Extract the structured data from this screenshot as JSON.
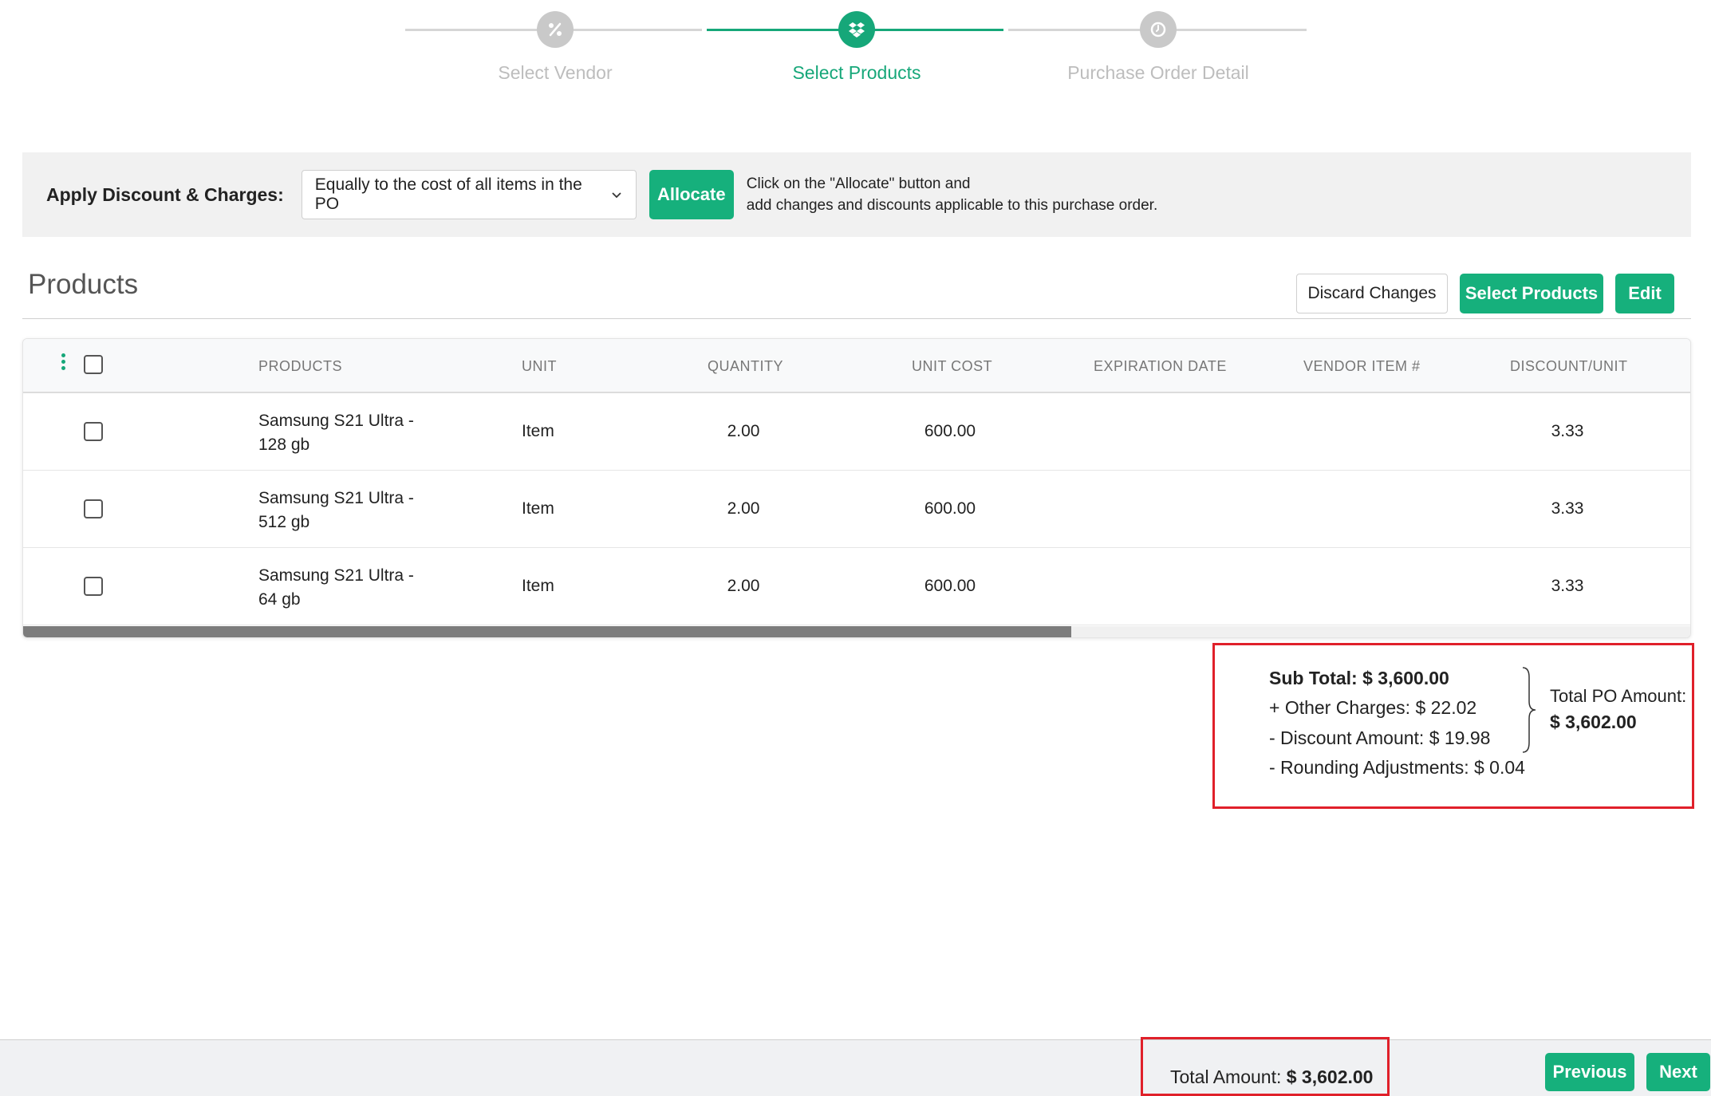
{
  "stepper": {
    "steps": [
      {
        "label": "Select Vendor",
        "icon": "percent-icon",
        "state": "inactive"
      },
      {
        "label": "Select Products",
        "icon": "dropbox-icon",
        "state": "active"
      },
      {
        "label": "Purchase Order Detail",
        "icon": "clock-icon",
        "state": "inactive"
      }
    ]
  },
  "discount": {
    "label": "Apply Discount & Charges:",
    "selected": "Equally to the cost of all items in the PO",
    "allocate_label": "Allocate",
    "hint_line1": "Click on the \"Allocate\" button and",
    "hint_line2": "add changes and discounts applicable to this purchase order."
  },
  "products": {
    "title": "Products",
    "discard_label": "Discard Changes",
    "select_label": "Select Products",
    "edit_label": "Edit"
  },
  "table": {
    "columns": [
      "PRODUCTS",
      "UNIT",
      "QUANTITY",
      "UNIT COST",
      "EXPIRATION DATE",
      "VENDOR ITEM #",
      "DISCOUNT/UNIT"
    ],
    "rows": [
      {
        "name_line1": "Samsung S21 Ultra -",
        "name_line2": "128 gb",
        "unit": "Item",
        "quantity": "2.00",
        "unit_cost": "600.00",
        "expiration": "",
        "vendor_item": "",
        "discount_unit": "3.33"
      },
      {
        "name_line1": "Samsung S21 Ultra -",
        "name_line2": "512 gb",
        "unit": "Item",
        "quantity": "2.00",
        "unit_cost": "600.00",
        "expiration": "",
        "vendor_item": "",
        "discount_unit": "3.33"
      },
      {
        "name_line1": "Samsung S21 Ultra -",
        "name_line2": "64 gb",
        "unit": "Item",
        "quantity": "2.00",
        "unit_cost": "600.00",
        "expiration": "",
        "vendor_item": "",
        "discount_unit": "3.33"
      }
    ]
  },
  "summary": {
    "sub_total": "Sub Total: $ 3,600.00",
    "other_charges": "+ Other Charges: $ 22.02",
    "discount_amount": "- Discount Amount: $ 19.98",
    "rounding": "- Rounding Adjustments: $ 0.04",
    "total_po_label": "Total PO Amount:",
    "total_po_value": "$ 3,602.00"
  },
  "footer": {
    "total_label": "Total Amount:",
    "total_value": "$ 3,602.00",
    "previous_label": "Previous",
    "next_label": "Next"
  },
  "colors": {
    "accent": "#16b07c",
    "highlight": "#e0202a"
  }
}
